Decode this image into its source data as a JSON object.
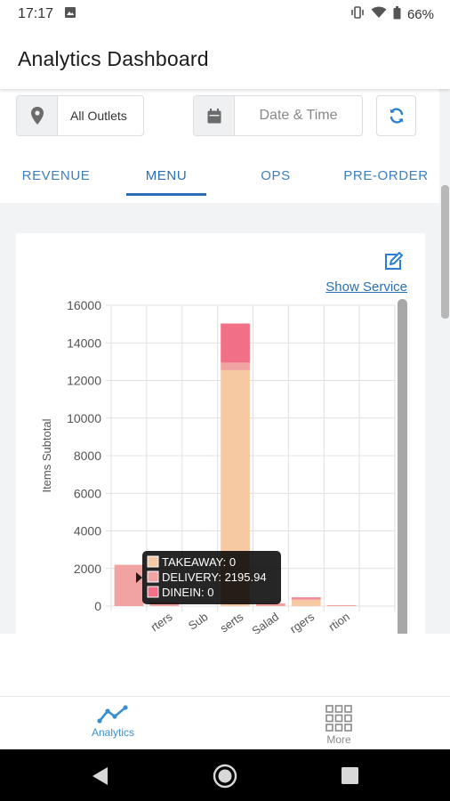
{
  "status_bar": {
    "time": "17:17",
    "battery": "66%"
  },
  "app_bar": {
    "title": "Analytics Dashboard"
  },
  "filters": {
    "outlet_label": "All Outlets",
    "datetime_placeholder": "Date & Time"
  },
  "tabs": [
    {
      "label": "REVENUE",
      "active": false
    },
    {
      "label": "MENU",
      "active": true
    },
    {
      "label": "OPS",
      "active": false
    },
    {
      "label": "PRE-ORDER",
      "active": false
    }
  ],
  "card": {
    "show_service_label": "Show Service"
  },
  "chart_data": {
    "type": "bar",
    "stacked": true,
    "ylabel": "Items Subtotal",
    "ylim": [
      0,
      16000
    ],
    "yticks": [
      0,
      2000,
      4000,
      6000,
      8000,
      10000,
      12000,
      14000,
      16000
    ],
    "categories": [
      "",
      "rters",
      "Sub",
      "serts",
      "Salad",
      "rgers",
      "rtion",
      ""
    ],
    "series": [
      {
        "name": "TAKEAWAY",
        "color": "#f7c9a3",
        "values": [
          0,
          0,
          0,
          12550,
          0,
          320,
          0,
          0
        ]
      },
      {
        "name": "DELIVERY",
        "color": "#f0a3a0",
        "values": [
          2195.94,
          200,
          0,
          400,
          150,
          80,
          50,
          0
        ]
      },
      {
        "name": "DINEIN",
        "color": "#f27085",
        "values": [
          0,
          0,
          0,
          2080,
          0,
          60,
          0,
          0
        ]
      }
    ],
    "tooltip": {
      "lines": [
        {
          "text": "TAKEAWAY: 0",
          "color": "#f7c9a3"
        },
        {
          "text": "DELIVERY: 2195.94",
          "color": "#f0a3a0"
        },
        {
          "text": "DINEIN: 0",
          "color": "#f27085"
        }
      ]
    },
    "grid": true
  },
  "bottom_nav": {
    "items": [
      {
        "label": "Analytics",
        "icon": "analytics-line-icon",
        "active": true
      },
      {
        "label": "More",
        "icon": "grid-icon",
        "active": false
      }
    ],
    "accent": "#3a8fd0"
  }
}
